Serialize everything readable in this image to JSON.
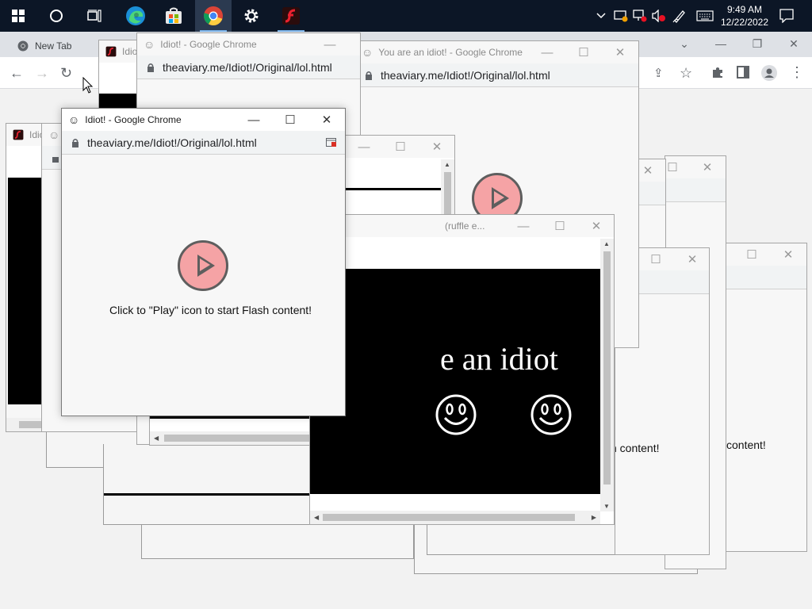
{
  "taskbar": {
    "clock_time": "9:49 AM",
    "clock_date": "12/22/2022",
    "accent": "#0c1626"
  },
  "chrome": {
    "tab_title": "New Tab"
  },
  "windows": {
    "front": {
      "title": "Idiot! - Google Chrome",
      "url": "theaviary.me/Idiot!/Original/lol.html",
      "message": "Click to \"Play\" icon to start Flash content!"
    },
    "top_center": {
      "title": "Idiot! - Google Chrome",
      "url": "theaviary.me/Idiot!/Original/lol.html"
    },
    "top_right": {
      "title": "You are an idiot! - Google Chrome",
      "url": "theaviary.me/Idiot!/Original/lol.html"
    },
    "left_small": {
      "title": "Idiot"
    },
    "back_left": {
      "title": "Idiot"
    },
    "middle": {
      "text": "idiot"
    },
    "ruffle": {
      "title": "(ruffle e...",
      "text": "e an idiot"
    },
    "right_a": {
      "message": "sh content!"
    },
    "right_b": {
      "message": "content!"
    }
  },
  "icons": [
    "windows-start-icon",
    "search-circle-icon",
    "task-view-icon",
    "edge-icon",
    "store-icon",
    "chrome-icon",
    "settings-icon",
    "flash-icon",
    "chevron-up-icon",
    "network-icon",
    "monitor-icon",
    "speaker-muted-icon",
    "pen-icon",
    "keyboard-icon",
    "notification-icon",
    "smiley-icon",
    "lock-icon",
    "play-icon"
  ],
  "colors": {
    "play_fill": "#f5a3a5",
    "play_stroke": "#5e5e5e"
  }
}
